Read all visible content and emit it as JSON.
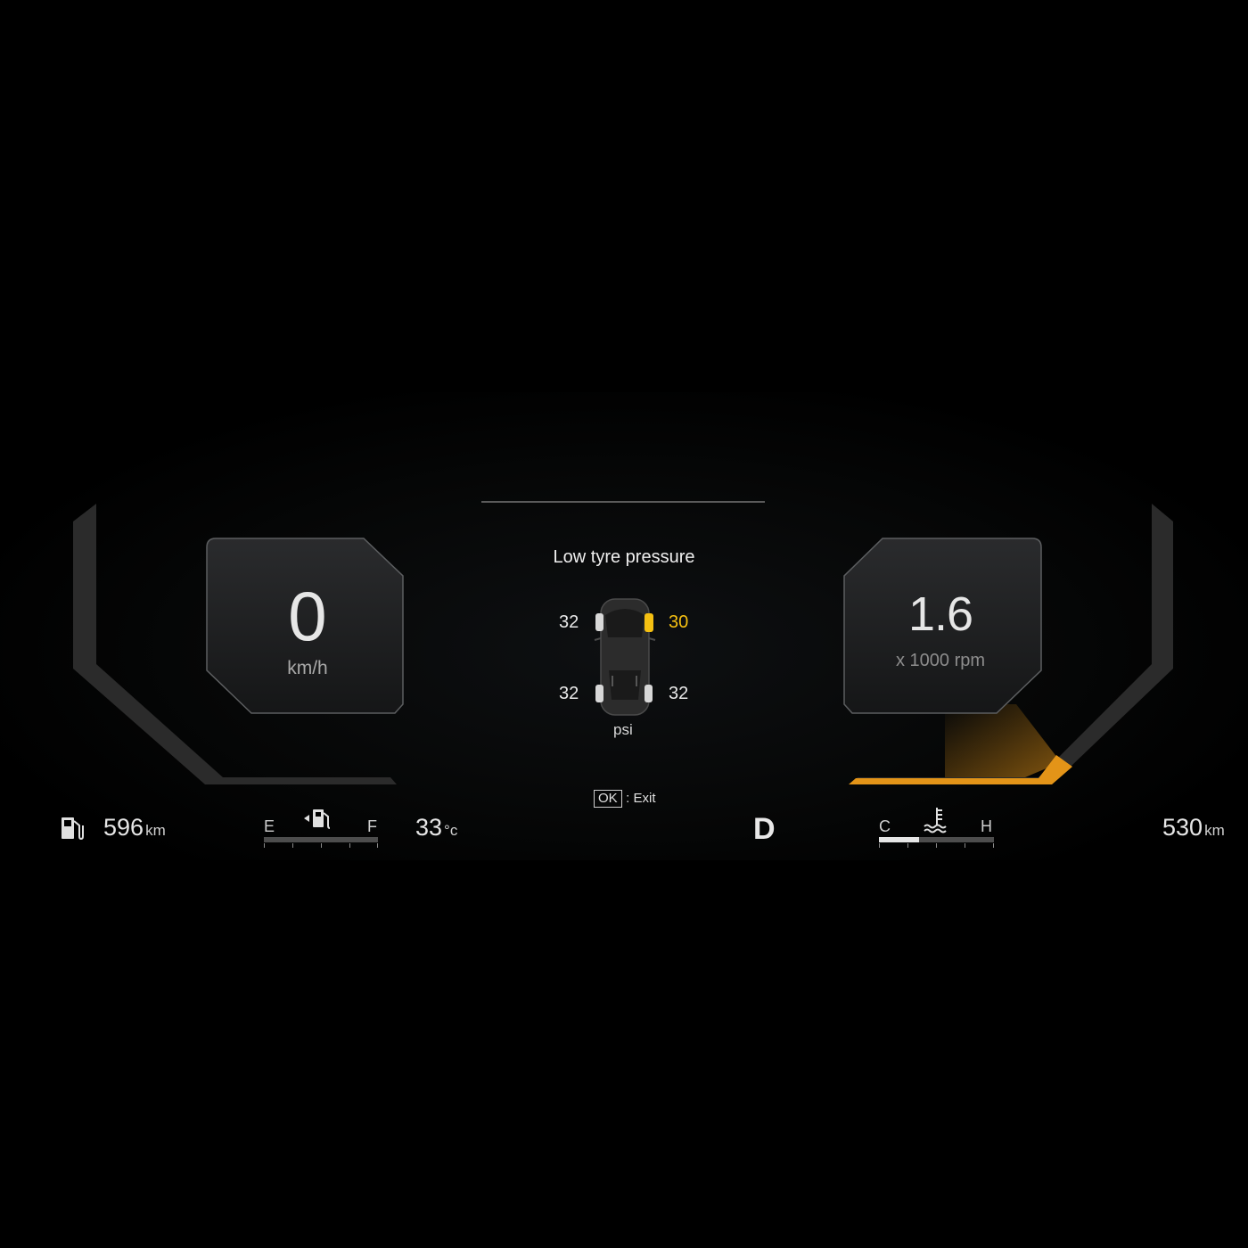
{
  "colors": {
    "background": "#000000",
    "frame": "#2b2b2b",
    "accent_warning": "#f5c012",
    "rpm_arc": "#e39418",
    "text": "#e6e6e6"
  },
  "speedometer": {
    "value": "0",
    "unit": "km/h"
  },
  "tachometer": {
    "value": "1.6",
    "unit": "x 1000 rpm",
    "level_fraction": 0.16
  },
  "tyre_pressure": {
    "title": "Low tyre pressure",
    "unit": "psi",
    "front_left": "32",
    "front_right": "30",
    "rear_left": "32",
    "rear_right": "32",
    "warning_tyre": "front_right",
    "ok_key": "OK",
    "exit_label": ": Exit"
  },
  "bottom_bar": {
    "fuel_range": {
      "icon": "fuel-pump-icon",
      "value": "596",
      "unit": "km"
    },
    "fuel_gauge": {
      "empty_label": "E",
      "full_label": "F",
      "icon": "fuel-door-icon",
      "level_fraction": 0.0
    },
    "outside_temp": {
      "value": "33",
      "unit": "°c"
    },
    "gear": "D",
    "coolant_gauge": {
      "cold_label": "C",
      "hot_label": "H",
      "icon": "coolant-temp-icon",
      "level_fraction": 0.35
    },
    "trip_distance": {
      "value": "530",
      "unit": "km"
    }
  }
}
